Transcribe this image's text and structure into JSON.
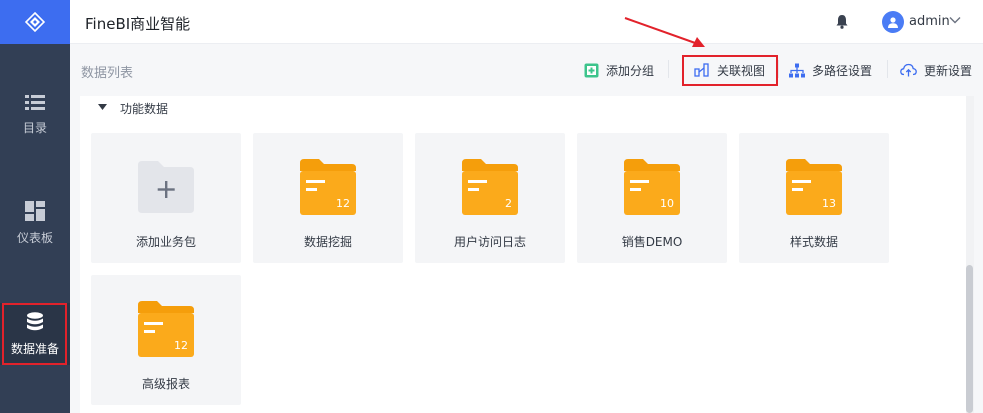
{
  "sidebar": {
    "items": [
      {
        "label": "目录",
        "icon": "list-icon"
      },
      {
        "label": "仪表板",
        "icon": "dashboard-icon"
      },
      {
        "label": "数据准备",
        "icon": "database-icon",
        "active": true
      }
    ]
  },
  "header": {
    "title": "FineBI商业智能",
    "user": "admin"
  },
  "toolbar": {
    "section_title": "数据列表",
    "add_group": "添加分组",
    "relation_view": "关联视图",
    "multipath": "多路径设置",
    "update_settings": "更新设置"
  },
  "group": {
    "label": "功能数据"
  },
  "cards": [
    {
      "label": "添加业务包",
      "type": "add"
    },
    {
      "label": "数据挖掘",
      "count": "12"
    },
    {
      "label": "用户访问日志",
      "count": "2"
    },
    {
      "label": "销售DEMO",
      "count": "10"
    },
    {
      "label": "样式数据",
      "count": "13"
    },
    {
      "label": "高级报表",
      "count": "12"
    }
  ],
  "colors": {
    "accent": "#3d6df0",
    "folder": "#fbaa1b",
    "highlight": "#e2222b",
    "sidebar": "#323f55"
  }
}
